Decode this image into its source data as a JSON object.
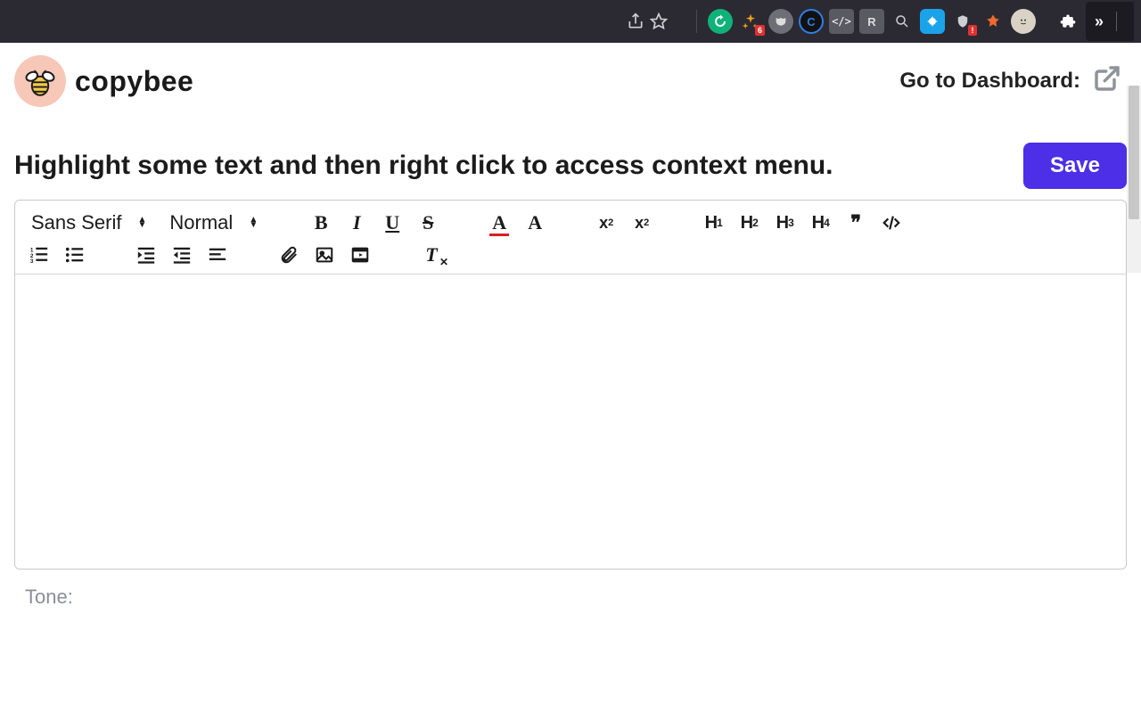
{
  "chrome": {
    "overflow_glyph": "»"
  },
  "header": {
    "brand_name": "copybee",
    "dashboard_label": "Go to Dashboard:"
  },
  "subhead": {
    "instruction": "Highlight some text and then right click to access context menu.",
    "save_label": "Save"
  },
  "toolbar": {
    "font_family": "Sans Serif",
    "font_size_label": "Normal",
    "bold": "B",
    "italic": "I",
    "underline": "U",
    "strike": "S",
    "text_color": "A",
    "bg_color": "A",
    "superscript": "x",
    "subscript": "x",
    "h1": "H",
    "h1n": "1",
    "h2": "H",
    "h2n": "2",
    "h3": "H",
    "h3n": "3",
    "h4": "H",
    "h4n": "4",
    "quote": "❞",
    "clear_T": "T"
  },
  "tone": {
    "label": "Tone:"
  },
  "colors": {
    "primary": "#4c2fe6"
  }
}
